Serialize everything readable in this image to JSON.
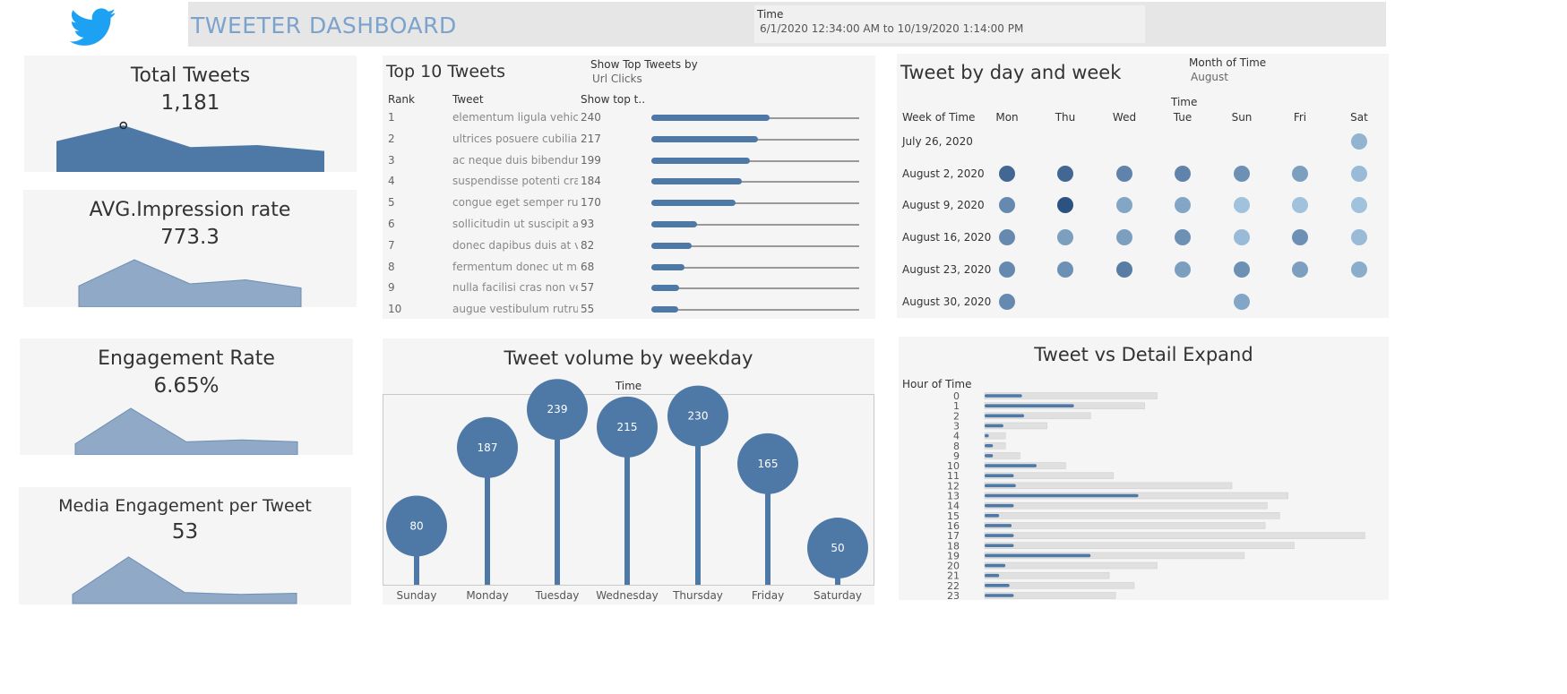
{
  "header": {
    "title": "TWEETER DASHBOARD",
    "filter_label": "Time",
    "filter_value": "6/1/2020 12:34:00 AM to 10/19/2020 1:14:00 PM"
  },
  "colors": {
    "primary": "#4e79a7",
    "header_text": "#7ba3cc",
    "area_light": "#8fa9c7",
    "track": "#999999",
    "panel": "#f5f5f5"
  },
  "kpis": [
    {
      "title": "Total Tweets",
      "value": "1,181",
      "trend": [
        0.6,
        1.0,
        0.45,
        0.5,
        0.35
      ]
    },
    {
      "title": "AVG.Impression rate",
      "value": "773.3",
      "trend": [
        0.35,
        1.0,
        0.4,
        0.5,
        0.3
      ]
    },
    {
      "title": "Engagement Rate",
      "value": "6.65%",
      "trend": [
        0.1,
        1.0,
        0.15,
        0.2,
        0.15
      ]
    },
    {
      "title": "Media Engagement per Tweet",
      "value": "53",
      "trend": [
        0.05,
        1.0,
        0.1,
        0.05,
        0.08
      ]
    }
  ],
  "top_tweets": {
    "title": "Top 10 Tweets",
    "control_label": "Show Top Tweets by",
    "control_value": "Url Clicks",
    "col_rank": "Rank",
    "col_tweet": "Tweet",
    "col_show": "Show top t..",
    "max": 240,
    "rows": [
      {
        "rank": "1",
        "tweet": "elementum ligula vehicula..",
        "value": 240
      },
      {
        "rank": "2",
        "tweet": "ultrices posuere cubilia cu..",
        "value": 217
      },
      {
        "rank": "3",
        "tweet": "ac neque duis bibendum ..",
        "value": 199
      },
      {
        "rank": "4",
        "tweet": "suspendisse potenti cras i..",
        "value": 184
      },
      {
        "rank": "5",
        "tweet": "congue eget semper rutru..",
        "value": 170
      },
      {
        "rank": "6",
        "tweet": "sollicitudin ut suscipit a f..",
        "value": 93
      },
      {
        "rank": "7",
        "tweet": "donec dapibus duis at veli..",
        "value": 82
      },
      {
        "rank": "8",
        "tweet": "fermentum donec ut maur..",
        "value": 68
      },
      {
        "rank": "9",
        "tweet": "nulla facilisi cras non velit..",
        "value": 57
      },
      {
        "rank": "10",
        "tweet": "augue vestibulum rutrum ..",
        "value": 55
      }
    ]
  },
  "calendar": {
    "title": "Tweet by day and week",
    "control_label": "Month of Time",
    "control_value": "August",
    "axis_label": "Time",
    "row_header": "Week of Time",
    "days": [
      "Mon",
      "Thu",
      "Wed",
      "Tue",
      "Sun",
      "Fri",
      "Sat"
    ],
    "weeks": [
      "July 26, 2020",
      "August 2, 2020",
      "August 9, 2020",
      "August 16, 2020",
      "August 23, 2020",
      "August 30, 2020"
    ],
    "cells": [
      [
        null,
        null,
        null,
        null,
        null,
        null,
        0.3
      ],
      [
        0.85,
        0.85,
        0.65,
        0.65,
        0.55,
        0.45,
        0.25
      ],
      [
        0.6,
        1.0,
        0.4,
        0.4,
        0.2,
        0.2,
        0.2
      ],
      [
        0.6,
        0.45,
        0.45,
        0.55,
        0.25,
        0.55,
        0.25
      ],
      [
        0.6,
        0.55,
        0.7,
        0.45,
        0.55,
        0.45,
        0.35
      ],
      [
        0.6,
        null,
        null,
        null,
        0.4,
        null,
        null
      ]
    ]
  },
  "weekday_chart": {
    "title": "Tweet volume by weekday",
    "axis_label": "Time",
    "chart_data": {
      "type": "lollipop",
      "categories": [
        "Sunday",
        "Monday",
        "Tuesday",
        "Wednesday",
        "Thursday",
        "Friday",
        "Saturday"
      ],
      "values": [
        80,
        187,
        239,
        215,
        230,
        165,
        50
      ],
      "title": "Tweet volume by weekday",
      "xlabel": "Time",
      "ylim": [
        0,
        260
      ]
    }
  },
  "hour_chart": {
    "title": "Tweet vs Detail Expand",
    "row_header": "Hour of Time",
    "chart_data": {
      "type": "bar",
      "title": "Tweet vs Detail Expand",
      "categories": [
        "0",
        "1",
        "2",
        "3",
        "4",
        "8",
        "9",
        "10",
        "11",
        "12",
        "13",
        "14",
        "15",
        "16",
        "17",
        "18",
        "19",
        "20",
        "21",
        "22",
        "23"
      ],
      "series": [
        {
          "values": [
            18,
            43,
            19,
            9,
            2,
            4,
            4,
            25,
            14,
            15,
            74,
            14,
            7,
            13,
            14,
            14,
            51,
            10,
            7,
            12,
            14
          ]
        },
        {
          "values": [
            83,
            77,
            51,
            30,
            10,
            10,
            17,
            39,
            62,
            119,
            146,
            136,
            142,
            135,
            183,
            149,
            125,
            83,
            60,
            72,
            63
          ]
        }
      ],
      "xlim": [
        0,
        185
      ]
    }
  }
}
